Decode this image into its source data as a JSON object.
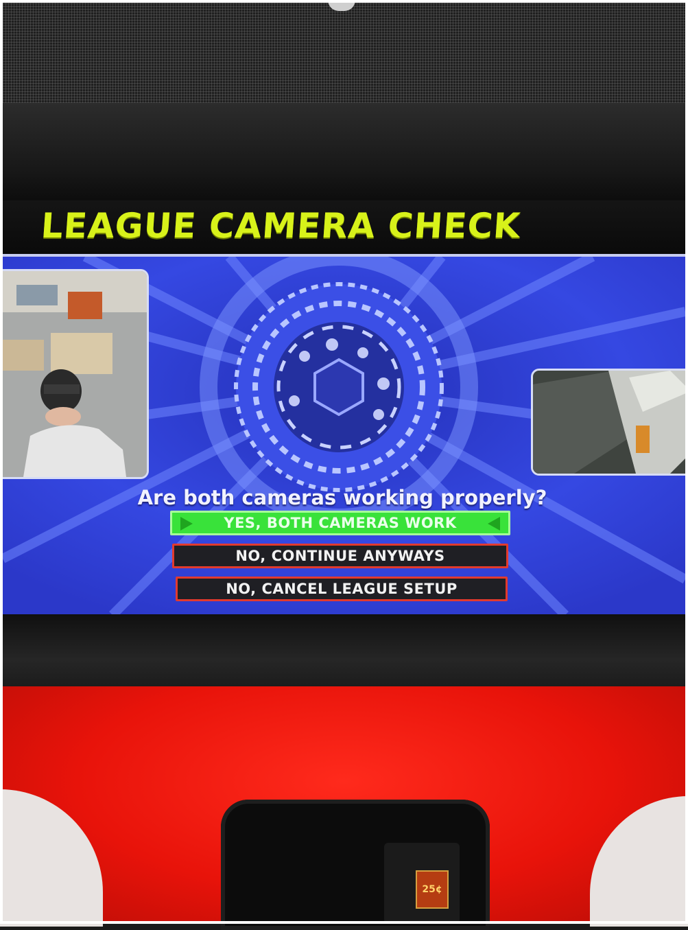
{
  "screen": {
    "title": "LEAGUE CAMERA CHECK",
    "prompt": "Are both cameras working properly?",
    "options": [
      {
        "label": "YES, BOTH CAMERAS WORK",
        "selected": true,
        "color": "#39e23a"
      },
      {
        "label": "NO, CONTINUE ANYWAYS",
        "selected": false,
        "color": "#e23a2e"
      },
      {
        "label": "NO, CANCEL LEAGUE SETUP",
        "selected": false,
        "color": "#e23a2e"
      }
    ]
  },
  "cameras": {
    "left_icon": "player-camera-feed-icon",
    "right_icon": "lane-camera-feed-icon"
  },
  "coin_slot": {
    "price": "25¢"
  },
  "colors": {
    "title": "#d8f21a",
    "screen_bg": "#2f3ed6",
    "cabinet": "#e8130a"
  }
}
